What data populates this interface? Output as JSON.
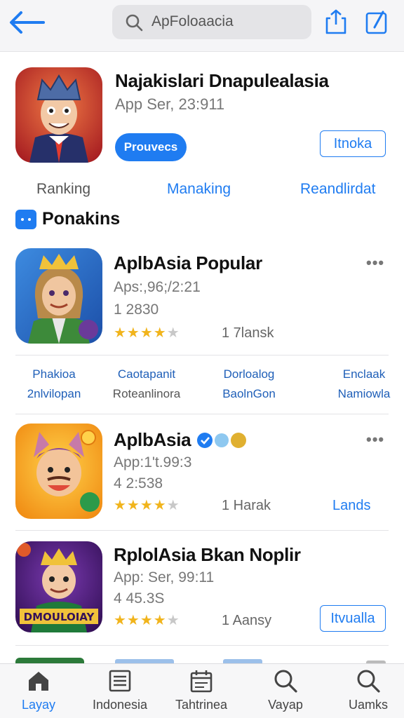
{
  "header": {
    "search_text": "ApFoloaacia",
    "icons": [
      "back-arrow-icon",
      "search-icon",
      "share-icon",
      "edit-icon"
    ]
  },
  "featured": {
    "name": "Najakislari Dnapulealasia",
    "subtitle": "App Ser, 23:911",
    "primary_button": "Prouvecs",
    "secondary_button": "Itnoka"
  },
  "tabs": [
    "Ranking",
    "Manaking",
    "Reandlirdat"
  ],
  "section_title": "Ponakins",
  "apps": [
    {
      "name": "AplbAsia Popular",
      "subtitle": "Aps:,96;/2:21",
      "count": "1 2830",
      "rating": 4,
      "rank": "1 7lansk"
    },
    {
      "name": "AplbAsia",
      "subtitle": "App:1't.99:3",
      "count": "4 2:538",
      "rating": 4,
      "rank": "1 Harak",
      "link": "Lands"
    },
    {
      "name": "RplolAsia Bkan Noplir",
      "subtitle": "App: Ser, 99:11",
      "count": "4 45.3S",
      "rating": 4,
      "rank": "1 Aansy",
      "button": "Itvualla"
    }
  ],
  "categories": [
    {
      "primary": "Phakioa",
      "secondary": "2nlvilopan"
    },
    {
      "primary": "Caotapanit",
      "secondary": "Roteanlinora"
    },
    {
      "primary": "Dorloalog",
      "secondary": "BaolnGon"
    },
    {
      "primary": "Enclaak",
      "secondary": "Namiowla"
    }
  ],
  "more_label": "•••",
  "bottom_tabs": [
    {
      "label": "Layay",
      "icon": "home-icon"
    },
    {
      "label": "Indonesia",
      "icon": "list-icon"
    },
    {
      "label": "Tahtrinea",
      "icon": "calendar-icon"
    },
    {
      "label": "Vayap",
      "icon": "search-icon"
    },
    {
      "label": "Uamks",
      "icon": "search-icon"
    }
  ],
  "colors": {
    "accent": "#1f7cf1",
    "star": "#f1b41c",
    "header_bg": "#f5f5f7",
    "icon_bg_featured": "#d2483a",
    "icon_bg_1": "#2f6fd2",
    "icon_bg_2": "#f3b21f",
    "icon_bg_3": "#4a1d7a"
  }
}
